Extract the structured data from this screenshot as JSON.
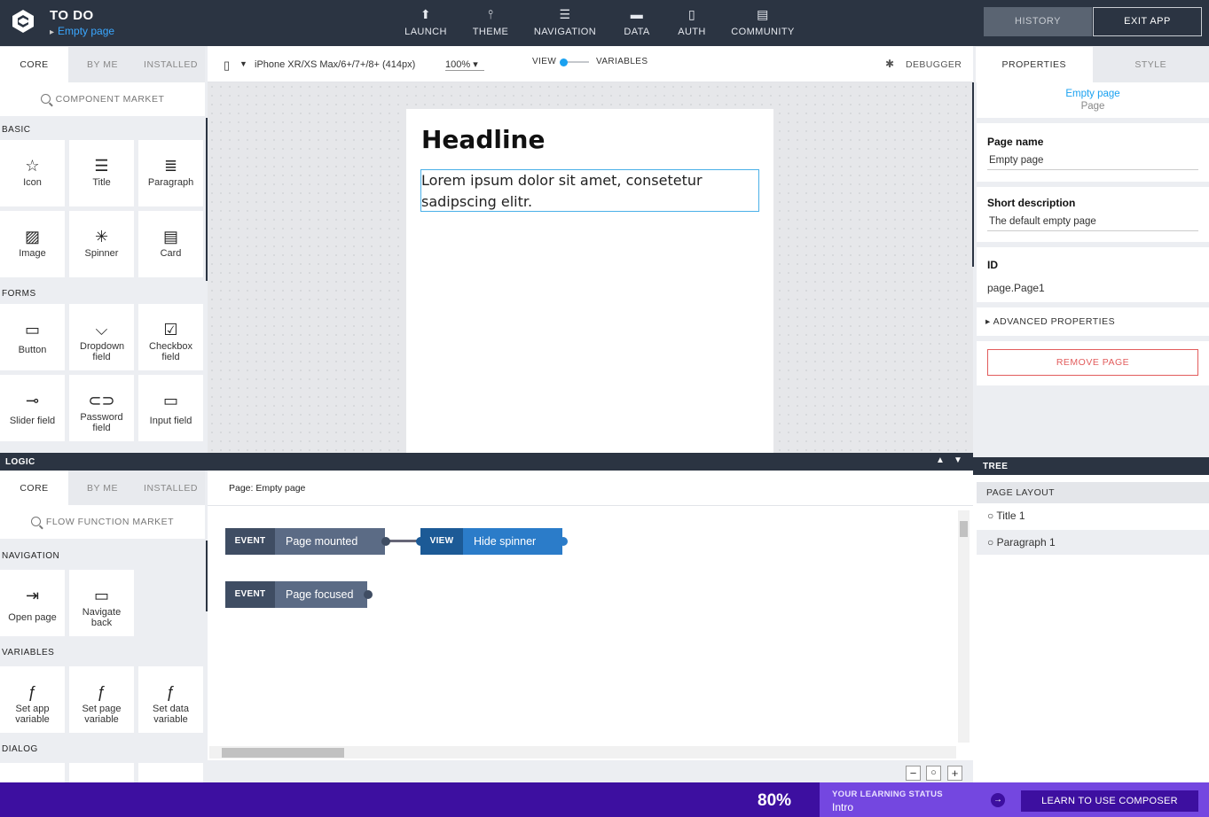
{
  "app": {
    "title": "TO DO",
    "current_page": "Empty page"
  },
  "topnav": [
    {
      "label": "LAUNCH",
      "icon": "launch-icon"
    },
    {
      "label": "THEME",
      "icon": "theme-icon"
    },
    {
      "label": "NAVIGATION",
      "icon": "navigation-icon"
    },
    {
      "label": "DATA",
      "icon": "data-icon"
    },
    {
      "label": "AUTH",
      "icon": "auth-icon"
    },
    {
      "label": "COMMUNITY",
      "icon": "community-icon"
    }
  ],
  "header_buttons": {
    "history": "HISTORY",
    "exit": "EXIT APP"
  },
  "left_tabs": [
    "CORE",
    "BY ME",
    "INSTALLED"
  ],
  "component_search": "COMPONENT MARKET",
  "sections": {
    "basic": "BASIC",
    "forms": "FORMS",
    "navigation": "NAVIGATION",
    "variables": "VARIABLES",
    "dialog": "DIALOG",
    "logic": "LOGIC"
  },
  "basic_items": [
    "Icon",
    "Title",
    "Paragraph",
    "Image",
    "Spinner",
    "Card"
  ],
  "form_items": [
    "Button",
    "Dropdown field",
    "Checkbox field",
    "Slider field",
    "Password field",
    "Input field"
  ],
  "toolbar": {
    "device": "iPhone XR/XS Max/6+/7+/8+ (414px)",
    "zoom": "100%",
    "view": "VIEW",
    "variables": "VARIABLES",
    "debugger": "DEBUGGER"
  },
  "canvas": {
    "headline": "Headline",
    "paragraph": "Lorem ipsum dolor sit amet, consetetur sadipscing elitr."
  },
  "right_tabs": [
    "PROPERTIES",
    "STYLE"
  ],
  "properties": {
    "page_link": "Empty page",
    "page_type": "Page",
    "page_name_label": "Page name",
    "page_name": "Empty page",
    "short_desc_label": "Short description",
    "short_desc": "The default empty page",
    "id_label": "ID",
    "id_value": "page.Page1",
    "advanced": "ADVANCED PROPERTIES",
    "remove": "REMOVE PAGE"
  },
  "logic_tabs": [
    "CORE",
    "BY ME",
    "INSTALLED"
  ],
  "flow_search": "FLOW FUNCTION MARKET",
  "nav_items": [
    "Open page",
    "Navigate back"
  ],
  "var_items": [
    "Set app variable",
    "Set page variable",
    "Set data variable"
  ],
  "flow": {
    "page_label": "Page: Empty page",
    "nodes": [
      {
        "kind": "EVENT",
        "label": "Page mounted"
      },
      {
        "kind": "VIEW",
        "label": "Hide spinner"
      },
      {
        "kind": "EVENT",
        "label": "Page focused"
      }
    ]
  },
  "tree": {
    "title": "TREE",
    "layout": "PAGE LAYOUT",
    "items": [
      "Title 1",
      "Paragraph 1"
    ]
  },
  "learning": {
    "percent": "80%",
    "status_label": "YOUR LEARNING STATUS",
    "status": "Intro",
    "button": "LEARN TO USE COMPOSER"
  }
}
